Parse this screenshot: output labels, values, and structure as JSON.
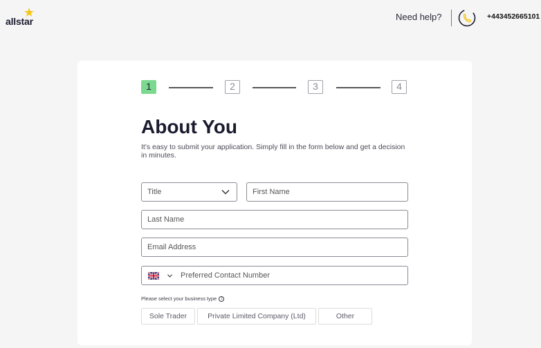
{
  "header": {
    "logo_text": "allstar",
    "need_help": "Need help?",
    "phone": "+443452665101"
  },
  "steps": [
    "1",
    "2",
    "3",
    "4"
  ],
  "active_step": 1,
  "form": {
    "title": "About You",
    "subtitle": "It's easy to submit your application. Simply fill in the form below and get a decision in minutes.",
    "title_select": {
      "placeholder": "Title"
    },
    "first_name": {
      "placeholder": "First Name",
      "value": ""
    },
    "last_name": {
      "placeholder": "Last Name",
      "value": ""
    },
    "email": {
      "placeholder": "Email Address",
      "value": ""
    },
    "contact": {
      "placeholder": "Preferred Contact Number",
      "value": "",
      "country_flag": "uk-flag-icon"
    },
    "business_type_label": "Please select your business type",
    "business_types": [
      "Sole Trader",
      "Private Limited Company (Ltd)",
      "Other"
    ]
  },
  "colors": {
    "accent_green": "#7bd88f",
    "star_yellow": "#f5c518",
    "background": "#f5f5f5"
  }
}
